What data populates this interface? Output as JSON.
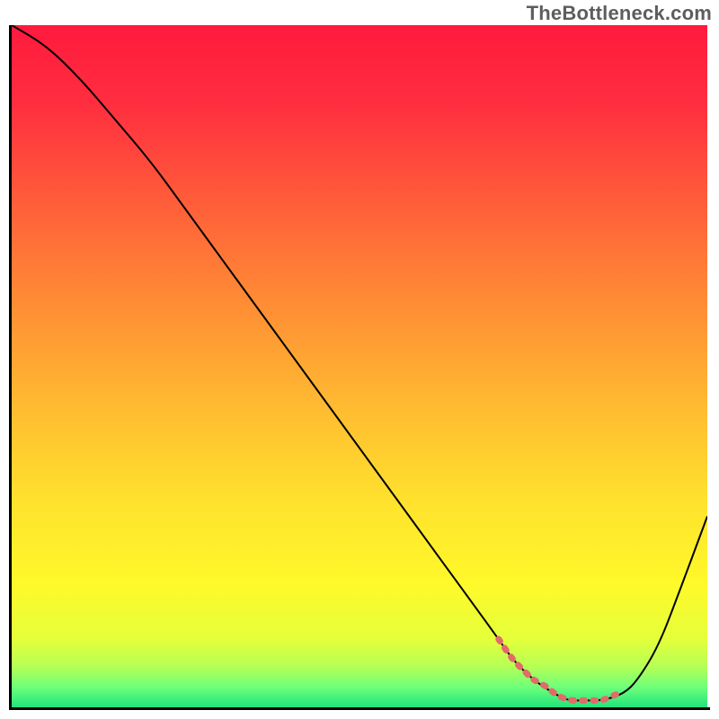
{
  "watermark": "TheBottleneck.com",
  "chart_data": {
    "type": "line",
    "title": "",
    "xlabel": "",
    "ylabel": "",
    "xlim": [
      0,
      100
    ],
    "ylim": [
      0,
      100
    ],
    "grid": false,
    "legend": false,
    "series": [
      {
        "name": "bottleneck-curve",
        "x": [
          0,
          5,
          10,
          15,
          20,
          25,
          30,
          35,
          40,
          45,
          50,
          55,
          60,
          65,
          70,
          72,
          75,
          78,
          80,
          82,
          85,
          88,
          90,
          93,
          96,
          100
        ],
        "values": [
          100,
          97,
          92,
          86,
          80,
          73,
          66,
          59,
          52,
          45,
          38,
          31,
          24,
          17,
          10,
          7,
          4,
          2,
          1,
          1,
          1,
          2,
          4,
          9,
          17,
          28
        ]
      },
      {
        "name": "highlight-segment",
        "x": [
          70,
          72,
          74,
          75,
          77,
          78,
          80,
          82,
          84,
          85,
          87,
          88
        ],
        "values": [
          10,
          7,
          5,
          4,
          3,
          2,
          1,
          1,
          1,
          1,
          2,
          2
        ]
      }
    ],
    "background_gradient": {
      "stops": [
        {
          "offset": 0.0,
          "color": "#ff1a3e"
        },
        {
          "offset": 0.12,
          "color": "#ff2f3f"
        },
        {
          "offset": 0.25,
          "color": "#ff5a3a"
        },
        {
          "offset": 0.4,
          "color": "#ff8a35"
        },
        {
          "offset": 0.55,
          "color": "#ffb831"
        },
        {
          "offset": 0.7,
          "color": "#ffe22d"
        },
        {
          "offset": 0.82,
          "color": "#fff92a"
        },
        {
          "offset": 0.9,
          "color": "#e4ff3a"
        },
        {
          "offset": 0.94,
          "color": "#b6ff55"
        },
        {
          "offset": 0.97,
          "color": "#6fff7a"
        },
        {
          "offset": 1.0,
          "color": "#1fe57a"
        }
      ]
    },
    "curve_color": "#000000",
    "highlight_color": "#e36a6a"
  }
}
